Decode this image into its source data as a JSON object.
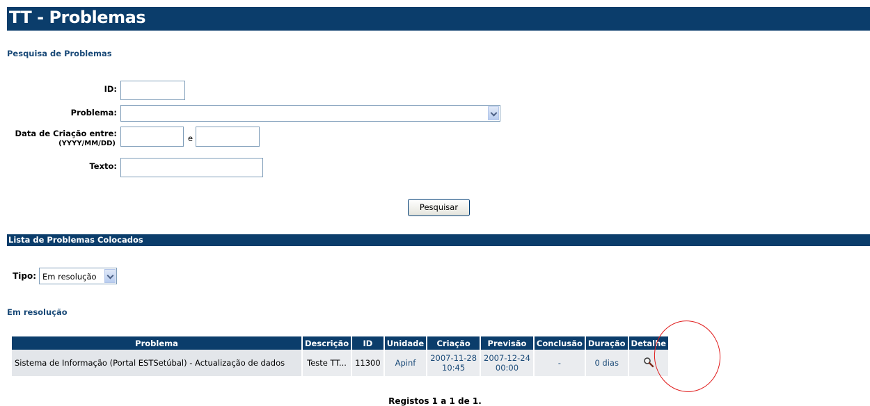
{
  "title": "TT - Problemas",
  "search": {
    "heading": "Pesquisa de Problemas",
    "id_label": "ID:",
    "id_value": "",
    "problema_label": "Problema:",
    "problema_value": "",
    "date_label": "Data de Criação entre:",
    "date_format": "(YYYY/MM/DD)",
    "date_from": "",
    "date_and": "e",
    "date_to": "",
    "texto_label": "Texto:",
    "texto_value": "",
    "button": "Pesquisar"
  },
  "list": {
    "heading": "Lista de Problemas Colocados",
    "tipo_label": "Tipo:",
    "tipo_value": "Em resolução",
    "subheading": "Em resolução",
    "columns": [
      "Problema",
      "Descrição",
      "ID",
      "Unidade",
      "Criação",
      "Previsão",
      "Conclusão",
      "Duração",
      "Detalhe"
    ],
    "rows": [
      {
        "problema": "Sistema de Informação (Portal ESTSetúbal) - Actualização de dados",
        "descricao": "Teste TT...",
        "id": "11300",
        "unidade": "Apinf",
        "criacao_date": "2007-11-28",
        "criacao_time": "10:45",
        "previsao_date": "2007-12-24",
        "previsao_time": "00:00",
        "conclusao": "-",
        "duracao": "0 dias",
        "detalhe_icon": "magnifier-icon"
      }
    ],
    "footer": "Registos 1 a 1 de 1."
  }
}
